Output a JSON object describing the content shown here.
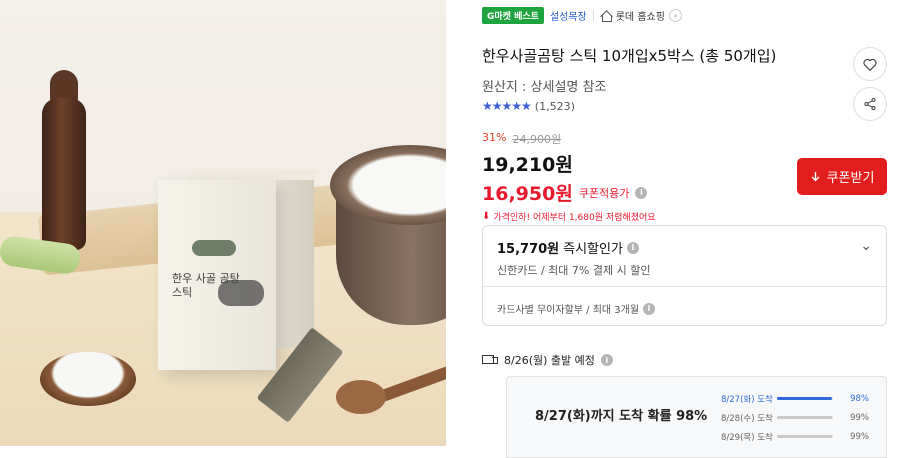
{
  "photo": {
    "box_title": "한우 사골 곰탕 스틱"
  },
  "tags": {
    "gmarket_best": "G마켓 베스트",
    "shop_name": "설성목장",
    "store_name": "롯데 홈쇼핑"
  },
  "product": {
    "title": "한우사골곰탕 스틱 10개입x5박스 (총 50개입)",
    "origin": "원산지 : 상세설명 참조",
    "rating_stars": "★★★★★",
    "review_count": "(1,523)"
  },
  "price": {
    "discount_pct": "31%",
    "original": "24,900원",
    "sale": "19,210원",
    "coupon_price": "16,950원",
    "coupon_label": "쿠폰적용가",
    "price_drop_text": "가격인하! 어제부터 1,680원 저렴해졌어요"
  },
  "buttons": {
    "coupon": "쿠폰받기"
  },
  "card_offer": {
    "price": "15,770원",
    "label": "즉시할인가",
    "detail": "신한카드 / 최대 7% 결제 시 할인",
    "installment": "카드사별 무이자할부 / 최대 3개월"
  },
  "shipping": {
    "departure": "8/26(월) 출발 예정",
    "probability_title": "8/27(화)까지 도착 확률 98%",
    "rows": [
      {
        "label": "8/27(화) 도착",
        "value": 98,
        "pct": "98%"
      },
      {
        "label": "8/28(수) 도착",
        "value": 99,
        "pct": "99%"
      },
      {
        "label": "8/29(목) 도착",
        "value": 99,
        "pct": "99%"
      }
    ]
  },
  "colors": {
    "accent_red": "#e11d1d",
    "gmarket_green": "#1da43f",
    "link_blue": "#2358c9",
    "star_blue": "#3a5fd2"
  }
}
